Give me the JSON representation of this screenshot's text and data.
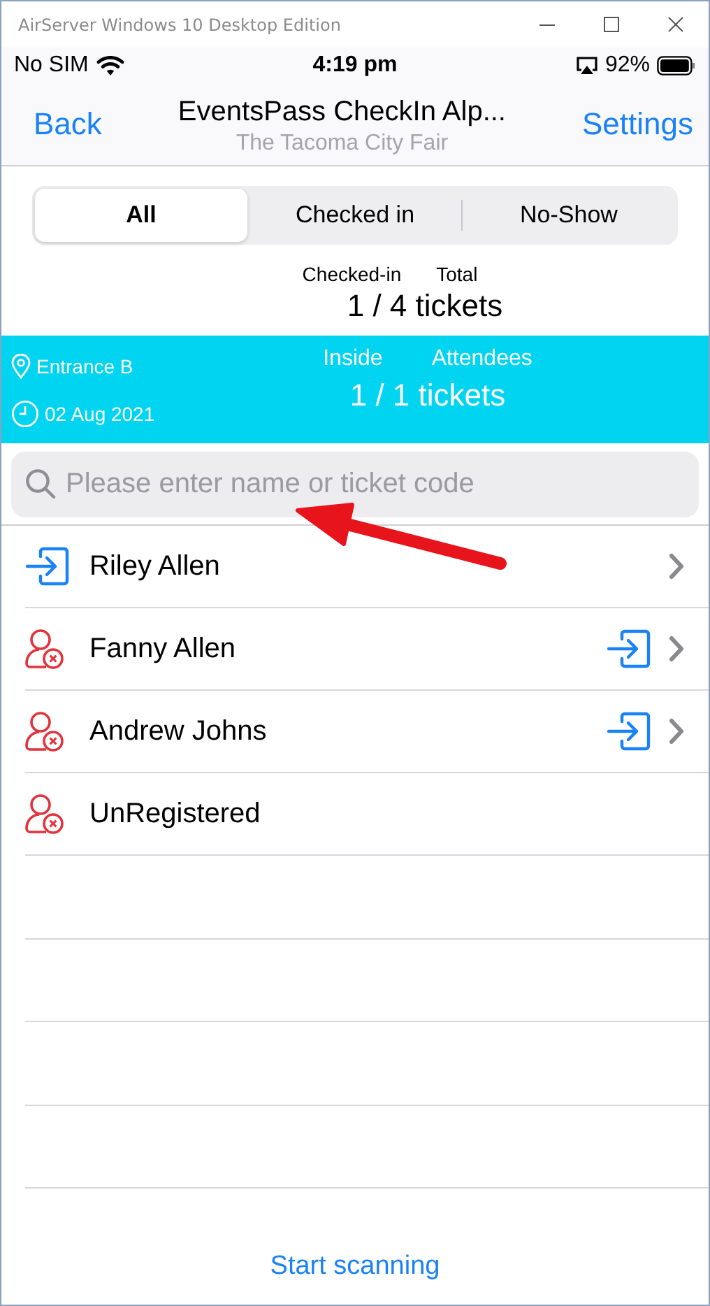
{
  "window": {
    "title": "AirServer Windows 10 Desktop Edition"
  },
  "status_bar": {
    "carrier": "No SIM",
    "time": "4:19 pm",
    "battery": "92%"
  },
  "nav": {
    "back": "Back",
    "title": "EventsPass CheckIn Alp...",
    "subtitle": "The Tacoma City Fair",
    "settings": "Settings"
  },
  "filter_tabs": [
    {
      "label": "All",
      "selected": true
    },
    {
      "label": "Checked in",
      "selected": false
    },
    {
      "label": "No-Show",
      "selected": false
    }
  ],
  "totals": {
    "label_1": "Checked-in",
    "label_2": "Total",
    "value": "1 / 4 tickets"
  },
  "gate": {
    "location": "Entrance B",
    "date": "02 Aug 2021",
    "label_1": "Inside",
    "label_2": "Attendees",
    "value": "1 / 1 tickets"
  },
  "search": {
    "placeholder": "Please enter name or ticket code"
  },
  "attendees": [
    {
      "name": "Riley Allen",
      "checked_in": true,
      "checkin_button": false,
      "disclosure": true
    },
    {
      "name": "Fanny Allen",
      "checked_in": false,
      "checkin_button": true,
      "disclosure": true
    },
    {
      "name": "Andrew Johns",
      "checked_in": false,
      "checkin_button": true,
      "disclosure": true
    },
    {
      "name": "UnRegistered",
      "checked_in": false,
      "checkin_button": false,
      "disclosure": false
    }
  ],
  "footer": {
    "action": "Start scanning"
  }
}
